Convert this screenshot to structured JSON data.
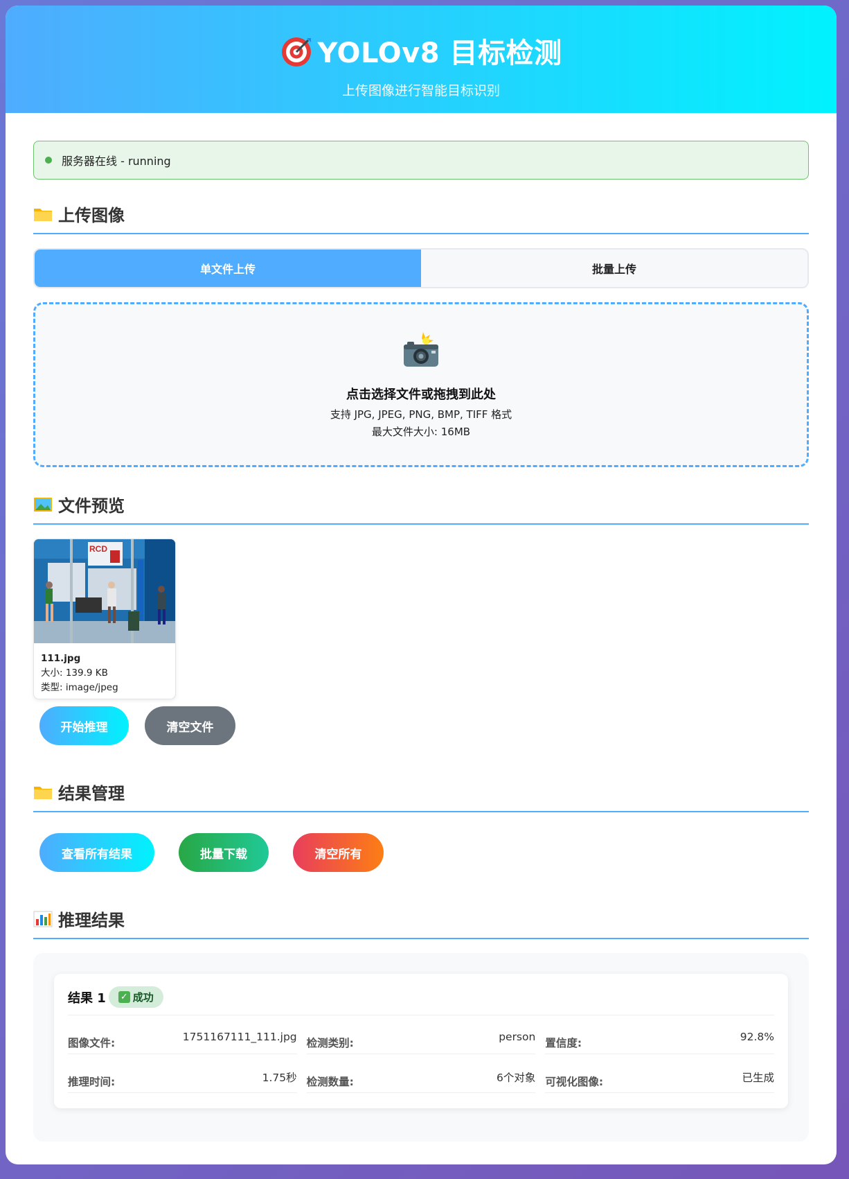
{
  "header": {
    "title": "YOLOv8 目标检测",
    "subtitle": "上传图像进行智能目标识别",
    "title_icon": "target-icon"
  },
  "status": {
    "text": "服务器在线 - running",
    "color": "#4caf50"
  },
  "upload": {
    "title": "上传图像",
    "icon": "folder-icon",
    "tabs": [
      {
        "label": "单文件上传",
        "active": true
      },
      {
        "label": "批量上传",
        "active": false
      }
    ],
    "dropzone": {
      "icon": "camera-flash-icon",
      "main_text": "点击选择文件或拖拽到此处",
      "formats_text": "支持 JPG, JPEG, PNG, BMP, TIFF 格式",
      "size_text": "最大文件大小: 16MB"
    }
  },
  "preview": {
    "title": "文件预览",
    "icon": "picture-icon",
    "file": {
      "name": "111.jpg",
      "size": "大小: 139.9 KB",
      "type": "类型: image/jpeg"
    },
    "actions": {
      "start": "开始推理",
      "clear": "清空文件"
    }
  },
  "manage": {
    "title": "结果管理",
    "icon": "folder-icon",
    "actions": {
      "view_all": "查看所有结果",
      "batch_download": "批量下载",
      "clear_all": "清空所有"
    }
  },
  "results": {
    "title": "推理结果",
    "icon": "bar-chart-icon",
    "items": [
      {
        "title": "结果 1",
        "badge": "成功",
        "fields": [
          {
            "key": "图像文件:",
            "value": "1751167111_111.jpg"
          },
          {
            "key": "检测类别:",
            "value": "person"
          },
          {
            "key": "置信度:",
            "value": "92.8%"
          },
          {
            "key": "推理时间:",
            "value": "1.75秒"
          },
          {
            "key": "检测数量:",
            "value": "6个对象"
          },
          {
            "key": "可视化图像:",
            "value": "已生成"
          }
        ]
      }
    ]
  },
  "colors": {
    "accent": "#4facfe",
    "accent_end": "#00f2fe",
    "success": "#28a745",
    "danger": "#e83e5c",
    "gray": "#6c757d"
  }
}
